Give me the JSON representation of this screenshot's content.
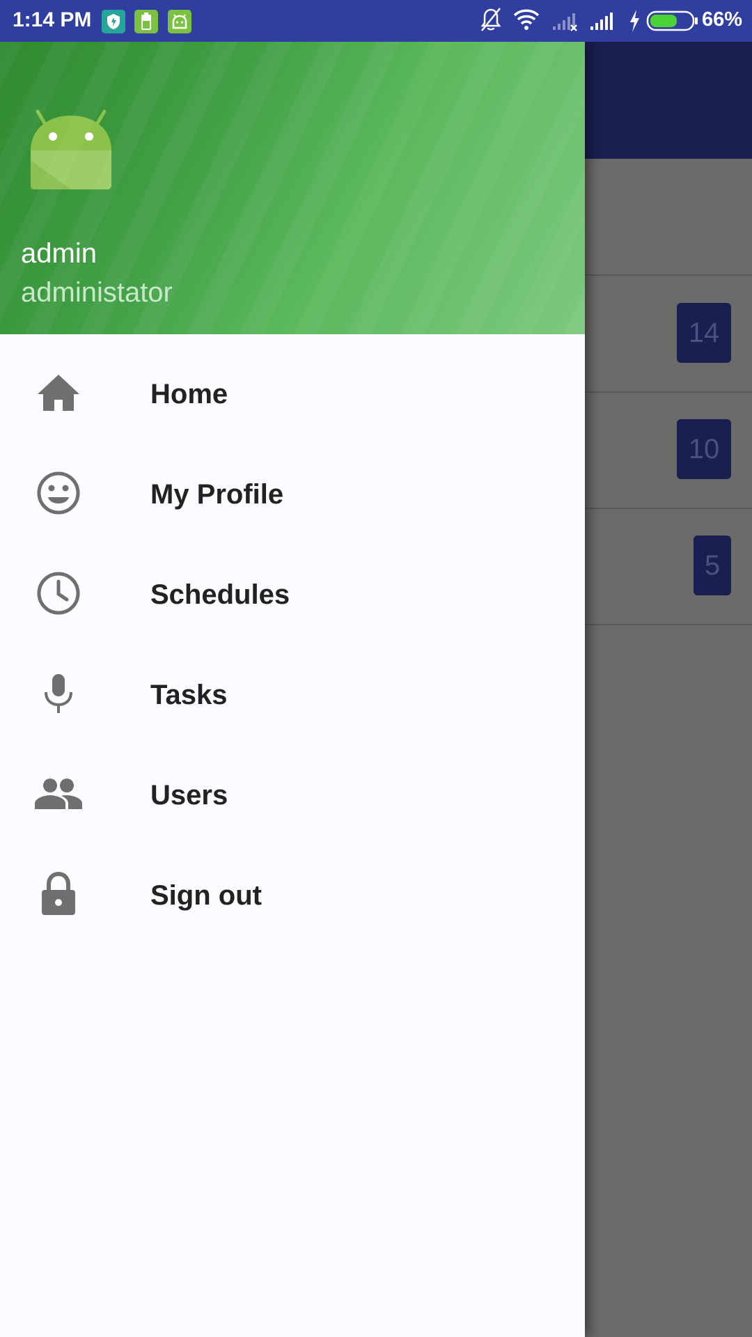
{
  "status_bar": {
    "time": "1:14 PM",
    "battery_percent": "66%",
    "notification_icons": [
      "shield-app-icon",
      "battery-app-icon",
      "android-app-icon"
    ],
    "system_icons": [
      "mute-icon",
      "wifi-icon",
      "signal-off-icon",
      "signal-icon",
      "charging-icon",
      "battery-icon"
    ],
    "battery_level": 0.66
  },
  "drawer": {
    "header": {
      "user_name": "admin",
      "user_role": "administator"
    },
    "menu": [
      {
        "label": "Home",
        "icon": "home-icon"
      },
      {
        "label": "My Profile",
        "icon": "smiley-icon"
      },
      {
        "label": "Schedules",
        "icon": "clock-icon"
      },
      {
        "label": "Tasks",
        "icon": "mic-icon"
      },
      {
        "label": "Users",
        "icon": "users-icon"
      },
      {
        "label": "Sign out",
        "icon": "lock-icon"
      }
    ]
  },
  "background_list": {
    "badges": [
      "14",
      "10",
      "5"
    ]
  },
  "colors": {
    "status_bar": "#303f9f",
    "toolbar": "#1a1f52",
    "header_green": "#43a047",
    "icon_grey": "#6f6f6f"
  }
}
